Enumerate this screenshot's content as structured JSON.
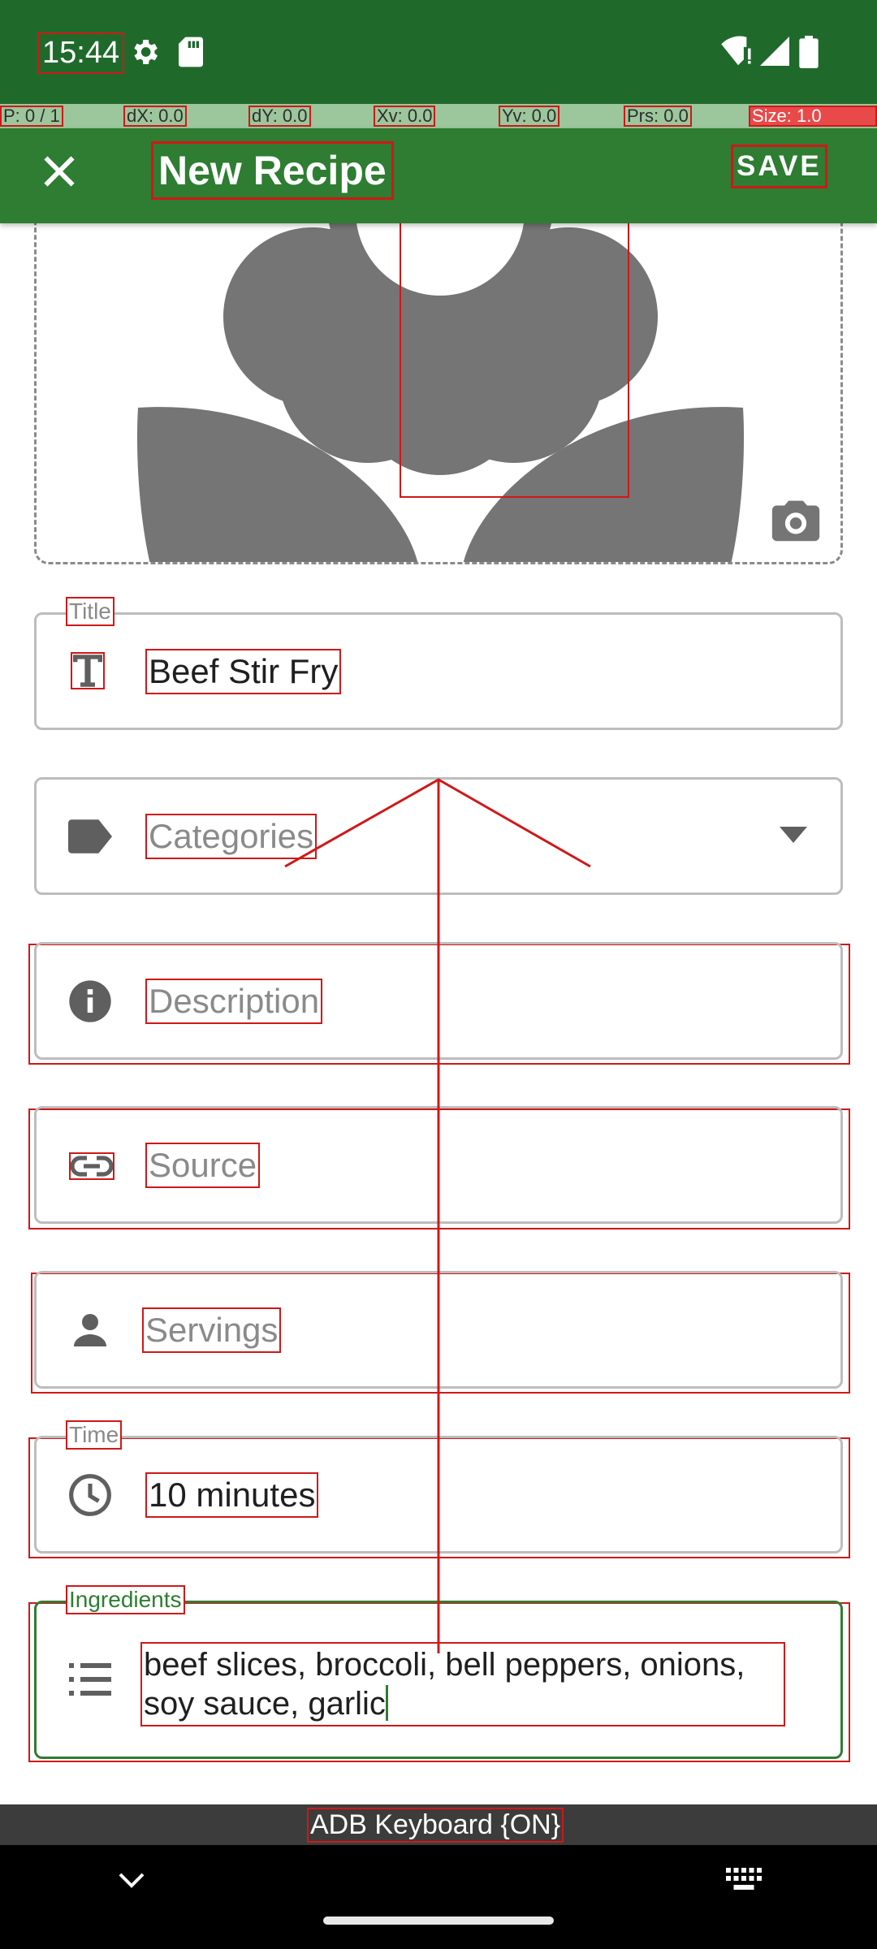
{
  "status_bar": {
    "time": "15:44"
  },
  "debug_bar": {
    "pointer": "P: 0 / 1",
    "dx": "dX: 0.0",
    "dy": "dY: 0.0",
    "xv": "Xv: 0.0",
    "yv": "Yv: 0.0",
    "prs": "Prs: 0.0",
    "size": "Size: 1.0"
  },
  "app_bar": {
    "title": "New Recipe",
    "save_label": "SAVE"
  },
  "form": {
    "title": {
      "label": "Title",
      "value": "Beef Stir Fry"
    },
    "categories": {
      "placeholder": "Categories"
    },
    "description": {
      "placeholder": "Description"
    },
    "source": {
      "placeholder": "Source"
    },
    "servings": {
      "placeholder": "Servings"
    },
    "time": {
      "label": "Time",
      "value": "10 minutes"
    },
    "ingredients": {
      "label": "Ingredients",
      "value_line1": "beef slices, broccoli, bell peppers, onions,",
      "value_line2": "soy sauce, garlic"
    }
  },
  "keyboard_bar": {
    "label": "ADB Keyboard {ON}"
  },
  "colors": {
    "status_bar": "#1f6a2b",
    "app_bar": "#2e7d32",
    "accent": "#2e7d32",
    "debug_outline": "#d01818",
    "placeholder_image": "#757575"
  }
}
